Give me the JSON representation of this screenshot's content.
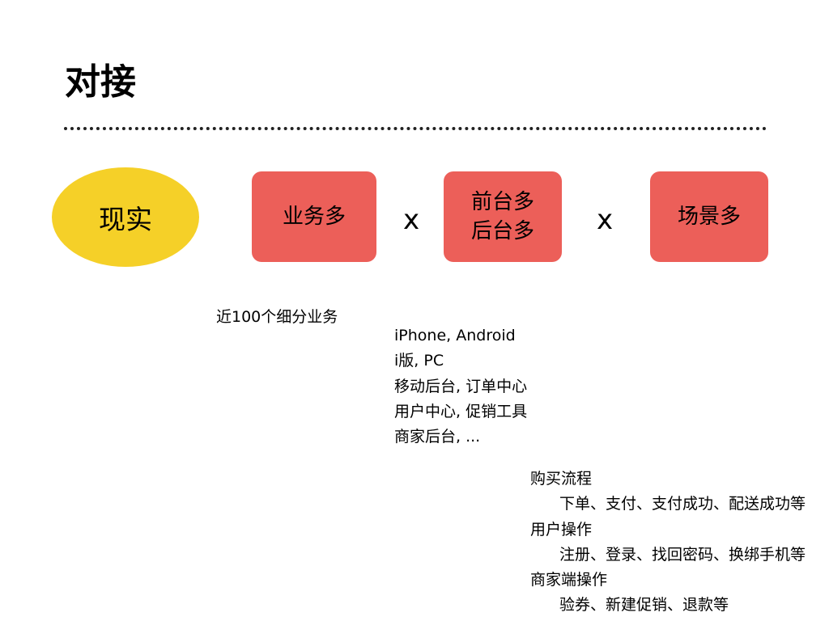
{
  "title": "对接",
  "colors": {
    "ellipse_fill": "#F5D028",
    "box_fill": "#EC5F59",
    "text": "#000000",
    "divider": "#222222"
  },
  "diagram": {
    "ellipse_label": "现实",
    "boxes": [
      {
        "lines": [
          "业务多"
        ]
      },
      {
        "lines": [
          "前台多",
          "后台多"
        ]
      },
      {
        "lines": [
          "场景多"
        ]
      }
    ],
    "operators": [
      "x",
      "x"
    ]
  },
  "notes": {
    "business": "近100个细分业务",
    "platforms": [
      "iPhone, Android",
      "i版, PC",
      "移动后台, 订单中心",
      "用户中心, 促销工具",
      "商家后台, ..."
    ],
    "scenarios": [
      {
        "text": "购买流程",
        "indent": false
      },
      {
        "text": "下单、支付、支付成功、配送成功等",
        "indent": true
      },
      {
        "text": "用户操作",
        "indent": false
      },
      {
        "text": "注册、登录、找回密码、换绑手机等",
        "indent": true
      },
      {
        "text": "商家端操作",
        "indent": false
      },
      {
        "text": "验券、新建促销、退款等",
        "indent": true
      }
    ]
  }
}
